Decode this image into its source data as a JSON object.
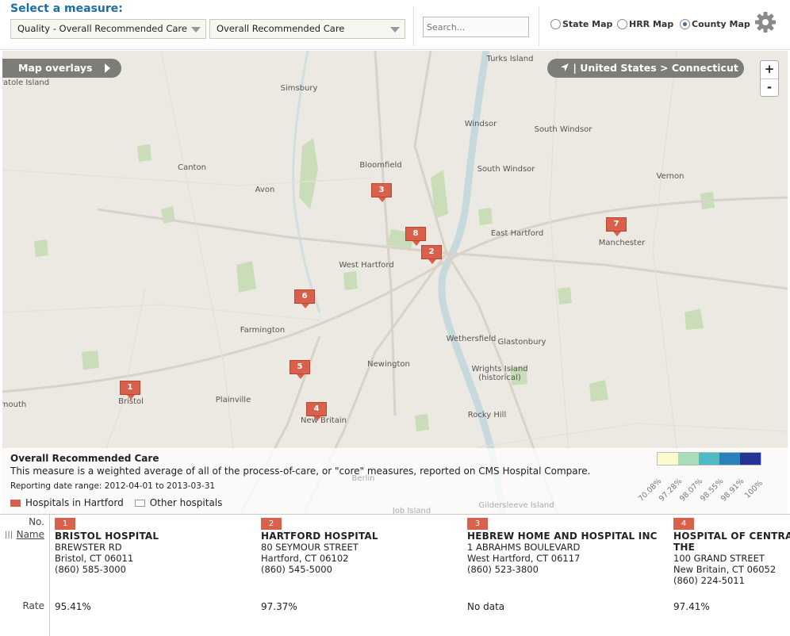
{
  "toolbar": {
    "select_title": "Select a measure:",
    "measure_category": "Quality - Overall Recommended Care",
    "measure": "Overall Recommended Care",
    "search_placeholder": "Search...",
    "map_types": [
      {
        "label": "State Map",
        "selected": false
      },
      {
        "label": "HRR Map",
        "selected": false
      },
      {
        "label": "County Map",
        "selected": true
      }
    ]
  },
  "map": {
    "overlays_label": "Map overlays",
    "breadcrumb": "| United States > Connecticut",
    "zoom_in": "+",
    "zoom_out": "-",
    "places": [
      "Turks Island",
      "ratole Island",
      "Simsbury",
      "Windsor",
      "South Windsor",
      "Canton",
      "Bloomfield",
      "Avon",
      "South Windsor",
      "Vernon",
      "East Hartford",
      "Manchester",
      "West Hartford",
      "Farmington",
      "Wethersfield",
      "Glastonbury",
      "Newington",
      "Wrights Island",
      "(historical)",
      "Bristol",
      "Plainville",
      "New Britain",
      "Rocky Hill",
      "mouth",
      "Berlin",
      "Gildersleeve Island",
      "Job Island"
    ],
    "markers": [
      "1",
      "2",
      "3",
      "4",
      "5",
      "6",
      "7",
      "8"
    ]
  },
  "legend": {
    "title": "Overall Recommended Care",
    "description": "This measure is a weighted average of all of the process-of-care, or \"core\" measures, reported on CMS Hospital Compare.",
    "date_range": "Reporting date range: 2012-04-01 to 2013-03-31",
    "hospitals_in": "Hospitals in Hartford",
    "other": "Other hospitals",
    "scale_colors": [
      "#fbfbcc",
      "#a9dcb9",
      "#4fb9c4",
      "#2c81ba",
      "#253494"
    ],
    "scale_labels": [
      "70.08%",
      "97.28%",
      "98.07%",
      "98.55%",
      "98.91%",
      "100%"
    ]
  },
  "table": {
    "no_header": "No.",
    "name_header": "Name",
    "rate_header": "Rate",
    "hospitals": [
      {
        "no": "1",
        "name": "BRISTOL HOSPITAL",
        "name2": "",
        "street": "BREWSTER RD",
        "city": "Bristol, CT 06011",
        "phone": "(860) 585-3000",
        "rate": "95.41%"
      },
      {
        "no": "2",
        "name": "HARTFORD HOSPITAL",
        "name2": "",
        "street": "80 SEYMOUR STREET",
        "city": "Hartford, CT 06102",
        "phone": "(860) 545-5000",
        "rate": "97.37%"
      },
      {
        "no": "3",
        "name": "HEBREW HOME AND HOSPITAL INC",
        "name2": "",
        "street": "1 ABRAHMS BOULEVARD",
        "city": "West Hartford, CT 06117",
        "phone": "(860) 523-3800",
        "rate": "No data"
      },
      {
        "no": "4",
        "name": "HOSPITAL OF CENTRAL",
        "name2": "THE",
        "street": "100 GRAND STREET",
        "city": "New Britain, CT 06052",
        "phone": "(860) 224-5011",
        "rate": "97.41%"
      }
    ]
  }
}
